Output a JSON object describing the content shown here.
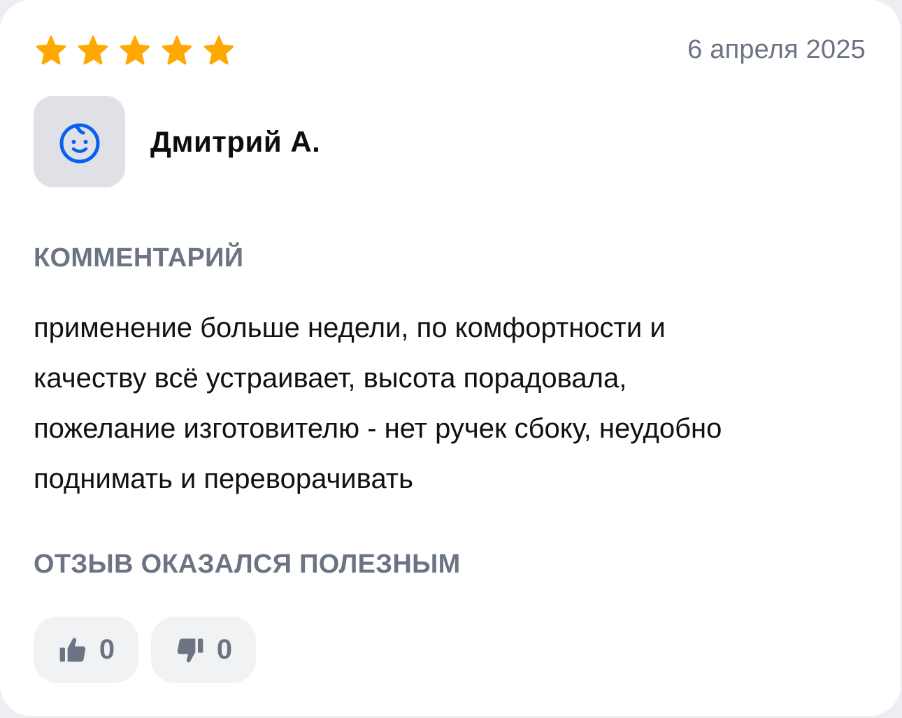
{
  "review": {
    "rating": 5,
    "rating_max": 5,
    "date": "6 апреля 2025",
    "author": {
      "name": "Дмитрий А.",
      "avatar_icon": "baby-face-icon"
    },
    "comment_label": "КОММЕНТАРИЙ",
    "comment_lines": [
      "применение больше недели, по комфортности и",
      "качеству всё устраивает, высота порадовала,",
      "пожелание изготовителю - нет ручек сбоку, неудобно",
      "поднимать и переворачивать"
    ],
    "useful_label": "ОТЗЫВ ОКАЗАЛСЯ ПОЛЕЗНЫМ",
    "likes": {
      "count": "0",
      "icon": "thumbs-up-icon"
    },
    "dislikes": {
      "count": "0",
      "icon": "thumbs-down-icon"
    }
  },
  "colors": {
    "star": "#FFA800",
    "avatar_bg": "#DFE1E6",
    "avatar_icon": "#0A5FEF",
    "muted_text": "#6C7483",
    "vote_bg": "#F1F2F4",
    "card_bg": "#FFFFFF"
  }
}
